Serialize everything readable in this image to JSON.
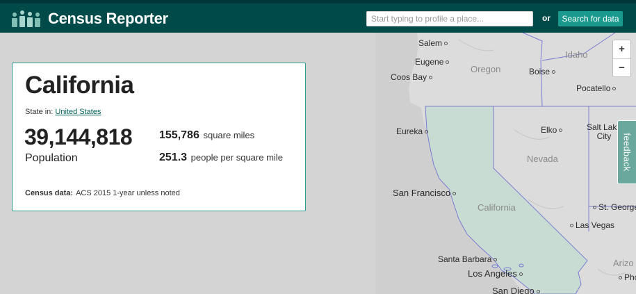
{
  "header": {
    "logo_text": "Census Reporter",
    "search_placeholder": "Start typing to profile a place...",
    "or_label": "or",
    "search_button": "Search for data"
  },
  "profile": {
    "name": "California",
    "state_in_label": "State in:",
    "state_in_link": "United States",
    "population_value": "39,144,818",
    "population_label": "Population",
    "area_value": "155,786",
    "area_unit": "square miles",
    "density_value": "251.3",
    "density_unit": "people per square mile",
    "census_label": "Census data:",
    "census_source": "ACS 2015 1-year unless noted"
  },
  "map": {
    "labels": {
      "salem": "Salem",
      "eugene": "Eugene",
      "coos_bay": "Coos Bay",
      "oregon": "Oregon",
      "idaho": "Idaho",
      "boise": "Boise",
      "pocatello": "Pocatello",
      "eureka": "Eureka",
      "elko": "Elko",
      "salt_lake_city": "Salt Lake City",
      "nevada": "Nevada",
      "san_francisco": "San Francisco",
      "california": "California",
      "st_george": "St. George",
      "las_vegas": "Las Vegas",
      "santa_barbara": "Santa Barbara",
      "los_angeles": "Los Angeles",
      "san_diego": "San Diego",
      "arizona": "Arizo",
      "phoenix": "Pho"
    },
    "zoom_in": "+",
    "zoom_out": "−",
    "feedback": "feedback",
    "highlight_color": "#c9dcd3",
    "border_color": "#7b7bd1"
  },
  "colors": {
    "header_bg": "#004a4a",
    "accent": "#1a9a8e"
  }
}
